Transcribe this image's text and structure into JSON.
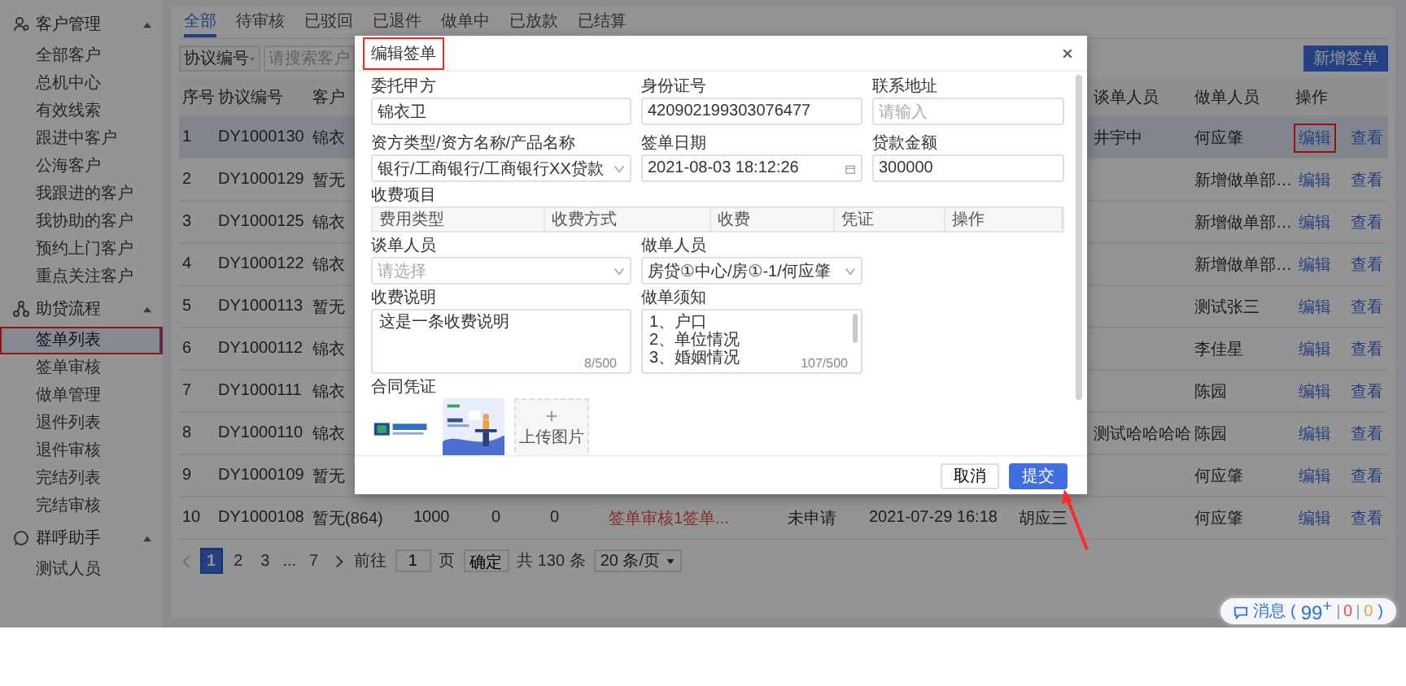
{
  "sidebar": {
    "groups": [
      {
        "title": "客户管理",
        "expanded": true,
        "items": [
          {
            "label": "全部客户",
            "selected": false,
            "annotated": false
          },
          {
            "label": "总机中心",
            "selected": false,
            "annotated": false
          },
          {
            "label": "有效线索",
            "selected": false,
            "annotated": false
          },
          {
            "label": "跟进中客户",
            "selected": false,
            "annotated": false
          },
          {
            "label": "公海客户",
            "selected": false,
            "annotated": false
          },
          {
            "label": "我跟进的客户",
            "selected": false,
            "annotated": false
          },
          {
            "label": "我协助的客户",
            "selected": false,
            "annotated": false
          },
          {
            "label": "预约上门客户",
            "selected": false,
            "annotated": false
          },
          {
            "label": "重点关注客户",
            "selected": false,
            "annotated": false
          }
        ]
      },
      {
        "title": "助贷流程",
        "expanded": true,
        "items": [
          {
            "label": "签单列表",
            "selected": true,
            "annotated": true
          },
          {
            "label": "签单审核",
            "selected": false,
            "annotated": false
          },
          {
            "label": "做单管理",
            "selected": false,
            "annotated": false
          },
          {
            "label": "退件列表",
            "selected": false,
            "annotated": false
          },
          {
            "label": "退件审核",
            "selected": false,
            "annotated": false
          },
          {
            "label": "完结列表",
            "selected": false,
            "annotated": false
          },
          {
            "label": "完结审核",
            "selected": false,
            "annotated": false
          }
        ]
      },
      {
        "title": "群呼助手",
        "expanded": true,
        "items": [
          {
            "label": "测试人员",
            "selected": false,
            "annotated": false
          }
        ]
      }
    ]
  },
  "tabs": [
    {
      "label": "全部",
      "selected": true
    },
    {
      "label": "待审核",
      "selected": false
    },
    {
      "label": "已驳回",
      "selected": false
    },
    {
      "label": "已退件",
      "selected": false
    },
    {
      "label": "做单中",
      "selected": false
    },
    {
      "label": "已放款",
      "selected": false
    },
    {
      "label": "已结算",
      "selected": false
    }
  ],
  "filter": {
    "field": "协议编号",
    "search_placeholder": "请搜索客户",
    "new_button": "新增签单"
  },
  "table": {
    "columns": [
      {
        "label": "序号",
        "kind": "text"
      },
      {
        "label": "协议编号",
        "kind": "text"
      },
      {
        "label": "客户",
        "kind": "text"
      },
      {
        "kind": "text"
      },
      {
        "kind": "text"
      },
      {
        "kind": "text"
      },
      {
        "kind": "status"
      },
      {
        "kind": "text"
      },
      {
        "kind": "text"
      },
      {
        "kind": "text"
      },
      {
        "label": "谈单人员",
        "kind": "text"
      },
      {
        "label": "做单人员",
        "kind": "text"
      },
      {
        "label": "操作",
        "kind": "actions"
      }
    ],
    "rows": [
      {
        "selected": true,
        "cells": [
          "1",
          "DY1000130",
          "锦衣",
          null,
          null,
          null,
          null,
          null,
          null,
          null,
          "井宇中",
          "何应肇"
        ],
        "actions": [
          {
            "label": "编辑",
            "annotated": true
          },
          {
            "label": "查看",
            "annotated": false
          }
        ]
      },
      {
        "selected": false,
        "cells": [
          "2",
          "DY1000129",
          "暂无",
          null,
          null,
          null,
          null,
          null,
          null,
          null,
          null,
          "新增做单部…"
        ],
        "actions": [
          {
            "label": "编辑",
            "annotated": false
          },
          {
            "label": "查看",
            "annotated": false
          }
        ]
      },
      {
        "selected": false,
        "cells": [
          "3",
          "DY1000125",
          "锦衣",
          null,
          null,
          null,
          null,
          null,
          null,
          null,
          null,
          "新增做单部…"
        ],
        "actions": [
          {
            "label": "编辑",
            "annotated": false
          },
          {
            "label": "查看",
            "annotated": false
          }
        ]
      },
      {
        "selected": false,
        "cells": [
          "4",
          "DY1000122",
          "锦衣",
          null,
          null,
          null,
          null,
          null,
          null,
          null,
          null,
          "新增做单部…"
        ],
        "actions": [
          {
            "label": "编辑",
            "annotated": false
          },
          {
            "label": "查看",
            "annotated": false
          }
        ]
      },
      {
        "selected": false,
        "cells": [
          "5",
          "DY1000113",
          "暂无",
          null,
          null,
          null,
          null,
          null,
          null,
          null,
          null,
          "测试张三"
        ],
        "actions": [
          {
            "label": "编辑",
            "annotated": false
          },
          {
            "label": "查看",
            "annotated": false
          }
        ]
      },
      {
        "selected": false,
        "cells": [
          "6",
          "DY1000112",
          "锦衣",
          null,
          null,
          null,
          null,
          null,
          null,
          null,
          null,
          "李佳星"
        ],
        "actions": [
          {
            "label": "编辑",
            "annotated": false
          },
          {
            "label": "查看",
            "annotated": false
          }
        ]
      },
      {
        "selected": false,
        "cells": [
          "7",
          "DY1000111",
          "锦衣",
          null,
          null,
          null,
          null,
          null,
          null,
          null,
          null,
          "陈园"
        ],
        "actions": [
          {
            "label": "编辑",
            "annotated": false
          },
          {
            "label": "查看",
            "annotated": false
          }
        ]
      },
      {
        "selected": false,
        "cells": [
          "8",
          "DY1000110",
          "锦衣",
          null,
          null,
          null,
          null,
          null,
          null,
          null,
          "测试哈哈哈哈",
          "陈园"
        ],
        "actions": [
          {
            "label": "编辑",
            "annotated": false
          },
          {
            "label": "查看",
            "annotated": false
          }
        ]
      },
      {
        "selected": false,
        "cells": [
          "9",
          "DY1000109",
          "暂无",
          null,
          null,
          null,
          null,
          null,
          null,
          null,
          null,
          "何应肇"
        ],
        "actions": [
          {
            "label": "编辑",
            "annotated": false
          },
          {
            "label": "查看",
            "annotated": false
          }
        ]
      },
      {
        "selected": false,
        "cells": [
          "10",
          "DY1000108",
          "暂无(864)",
          "1000",
          "0",
          "0",
          "签单审核1签单...",
          "未申请",
          "2021-07-29 16:18",
          "胡应三",
          null,
          "何应肇"
        ],
        "actions": [
          {
            "label": "编辑",
            "annotated": false
          },
          {
            "label": "查看",
            "annotated": false
          }
        ]
      }
    ]
  },
  "pagination": {
    "pages": [
      {
        "label": "1",
        "kind": "page",
        "selected": true
      },
      {
        "label": "2",
        "kind": "page",
        "selected": false
      },
      {
        "label": "3",
        "kind": "page",
        "selected": false
      },
      {
        "label": "...",
        "kind": "ellipsis"
      },
      {
        "label": "7",
        "kind": "page",
        "selected": false
      }
    ],
    "goto_label": "前往",
    "goto_value": "1",
    "page_unit": "页",
    "confirm": "确定",
    "total": "共 130 条",
    "page_size": "20 条/页"
  },
  "messages": {
    "label": "消息",
    "open": "(",
    "close": ")",
    "counts": [
      {
        "text": "99$^{+}$",
        "color": "#2f6fe0"
      },
      {
        "text": "0",
        "color": "#e0533d"
      },
      {
        "text": "0",
        "color": "#e6a23c"
      }
    ]
  },
  "dialog": {
    "title": "编辑签单",
    "title_annotated": true,
    "fields": [
      {
        "kind": "input",
        "label": "委托甲方",
        "value": "锦衣卫"
      },
      {
        "kind": "input",
        "label": "身份证号",
        "value": "420902199303076477"
      },
      {
        "kind": "input",
        "label": "联系地址",
        "placeholder": "请输入"
      },
      {
        "kind": "select",
        "label": "资方类型/资方名称/产品名称",
        "value": "银行/工商银行/工商银行XX贷款"
      },
      {
        "kind": "date",
        "label": "签单日期",
        "value": "2021-08-03 18:12:26"
      },
      {
        "kind": "input",
        "label": "贷款金额",
        "value": "300000"
      }
    ],
    "fee_items": {
      "label": "收费项目",
      "columns": [
        "费用类型",
        "收费方式",
        "收费",
        "凭证",
        "操作"
      ]
    },
    "staff_fields": [
      {
        "kind": "select",
        "label": "谈单人员",
        "placeholder": "请选择"
      },
      {
        "kind": "select",
        "label": "做单人员",
        "value": "房贷①中心/房①-1/何应肇"
      }
    ],
    "notes": [
      {
        "label": "收费说明",
        "lines": [
          "这是一条收费说明"
        ],
        "counter": "8/500",
        "scrollable": false
      },
      {
        "label": "做单须知",
        "lines": [
          "1、户口",
          "2、单位情况",
          "3、婚姻情况"
        ],
        "counter": "107/500",
        "scrollable": true
      }
    ],
    "attachments": {
      "label": "合同凭证",
      "upload_label": "上传图片"
    },
    "buttons": [
      {
        "label": "取消",
        "kind": "default"
      },
      {
        "label": "提交",
        "kind": "primary"
      }
    ]
  }
}
